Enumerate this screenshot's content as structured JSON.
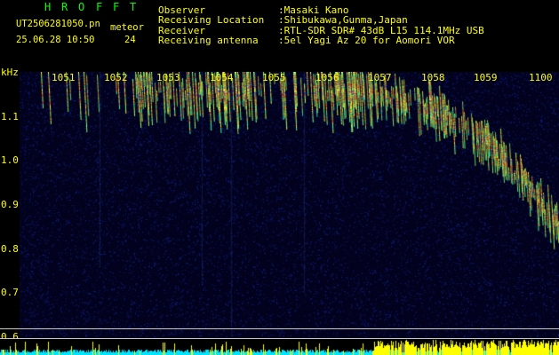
{
  "header": {
    "title_letters": [
      "H",
      "R",
      "O",
      "F",
      "F",
      "T"
    ],
    "filename": "UT2506281050.pn",
    "mode": "meteor",
    "date_time": "25.06.28 10:50",
    "count": "24",
    "observer_label": "Observer",
    "observer_value": ":Masaki Kano",
    "location_label": "Receiving Location",
    "location_value": ":Shibukawa,Gunma,Japan",
    "receiver_label": "Receiver",
    "receiver_value": ":RTL-SDR SDR# 43dB L15 114.1MHz USB",
    "antenna_label": "Receiving antenna",
    "antenna_value": ":5el Yagi Az 20 for Aomori VOR"
  },
  "axes": {
    "y_unit": "kHz",
    "y_ticks": [
      "1.1",
      "1.0",
      "0.9",
      "0.8",
      "0.7",
      "0.6"
    ],
    "x_ticks": [
      "1051",
      "1052",
      "1053",
      "1054",
      "1055",
      "1056",
      "1057",
      "1058",
      "1059",
      "1100"
    ]
  },
  "colors": {
    "text_yellow": "#ffff00",
    "title_green": "#00ff00",
    "background": "#000000",
    "spectrogram_bg": "#02021e",
    "intensity_cyan": "#00e5ff",
    "intensity_yellow": "#ffff00"
  }
}
